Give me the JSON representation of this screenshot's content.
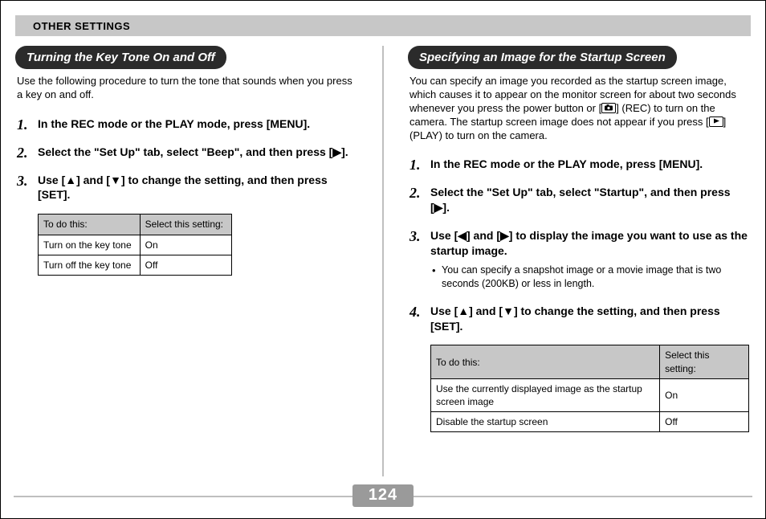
{
  "header": "OTHER SETTINGS",
  "page_number": "124",
  "left": {
    "title": "Turning the Key Tone On and Off",
    "intro": "Use the following procedure to turn the tone that sounds when you press a key on and off.",
    "steps": {
      "s1": "In the REC mode or the PLAY mode, press [MENU].",
      "s2": "Select the \"Set Up\" tab, select \"Beep\", and then press [▶].",
      "s3": "Use [▲] and [▼] to change the setting, and then press [SET]."
    },
    "table": {
      "h1": "To do this:",
      "h2": "Select this setting:",
      "r1c1": "Turn on the key tone",
      "r1c2": "On",
      "r2c1": "Turn off the key tone",
      "r2c2": "Off"
    }
  },
  "right": {
    "title": "Specifying an Image for the Startup Screen",
    "intro_a": "You can specify an image you recorded as the startup screen image, which causes it to appear on the monitor screen for about two seconds whenever you press the power button or [",
    "intro_b": "] (REC) to turn on the camera. The startup screen image does not appear if you press [",
    "intro_c": "] (PLAY) to turn on the camera.",
    "steps": {
      "s1": "In the REC mode or the PLAY mode, press [MENU].",
      "s2": "Select the \"Set Up\" tab, select \"Startup\", and then press [▶].",
      "s3": "Use [◀] and [▶] to display the image you want to use as the startup image.",
      "s3_note": "You can specify a snapshot image or a movie image that is two seconds (200KB) or less in length.",
      "s4": "Use [▲] and [▼] to change the setting, and then press [SET]."
    },
    "table": {
      "h1": "To do this:",
      "h2": "Select this setting:",
      "r1c1": "Use the currently displayed image as the startup screen image",
      "r1c2": "On",
      "r2c1": "Disable the startup screen",
      "r2c2": "Off"
    }
  }
}
